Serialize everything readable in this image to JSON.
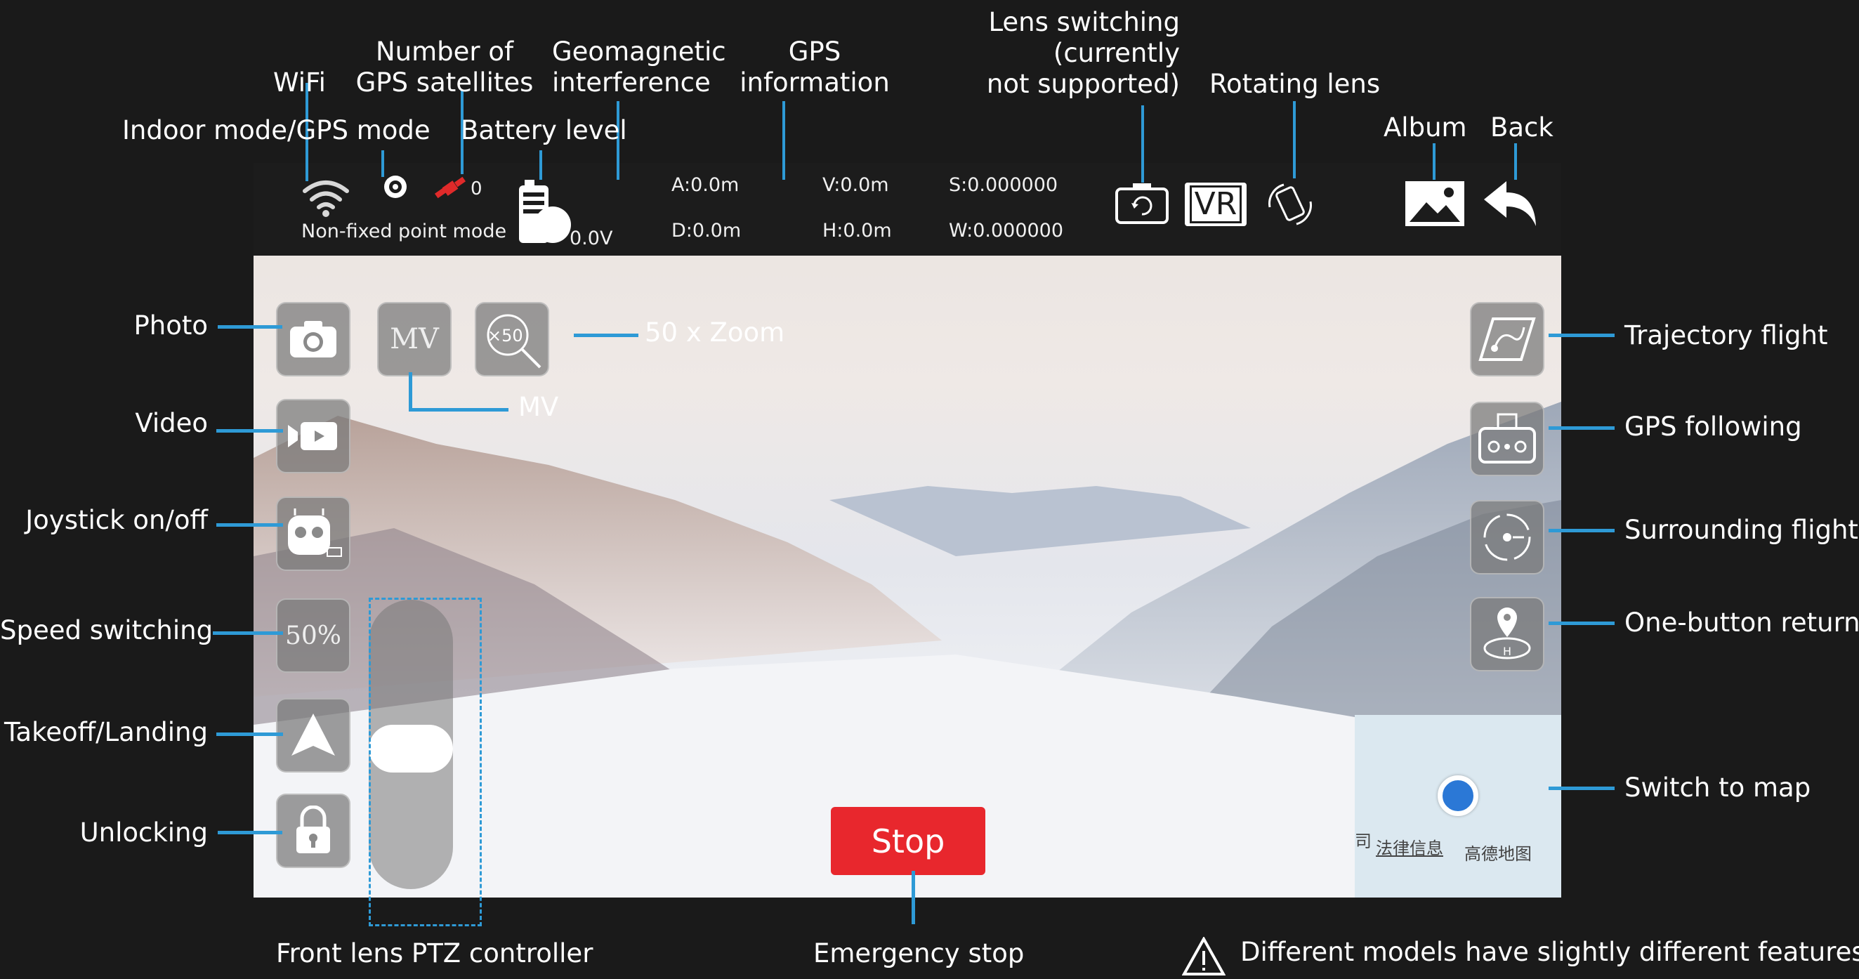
{
  "status_bar": {
    "mode_text": "Non-fixed point mode",
    "satellites": "0",
    "voltage": "0.0V",
    "gps": {
      "a": "A:0.0m",
      "d": "D:0.0m",
      "v": "V:0.0m",
      "h": "H:0.0m",
      "s": "S:0.000000",
      "w": "W:0.000000"
    },
    "vr_label": "VR"
  },
  "left_buttons": {
    "speed": "50%",
    "mv": "MV",
    "zoom": "×50"
  },
  "stop_label": "Stop",
  "map": {
    "legal": "法律信息",
    "brand": "高德地图",
    "prefix": "司"
  },
  "annotations": {
    "wifi": "WiFi",
    "satellites": "Number of\nGPS satellites",
    "indoor_mode": "Indoor mode/GPS mode",
    "battery": "Battery level",
    "geomagnetic": "Geomagnetic\ninterference",
    "gps_info": "GPS\ninformation",
    "lens_switch": "Lens switching\n(currently\nnot supported)",
    "rotating_lens": "Rotating lens",
    "album": "Album",
    "back": "Back",
    "photo": "Photo",
    "video": "Video",
    "joystick": "Joystick on/off",
    "speed": "Speed switching",
    "takeoff": "Takeoff/Landing",
    "unlocking": "Unlocking",
    "zoom": "50 x Zoom",
    "mv": "MV",
    "trajectory": "Trajectory flight",
    "gps_following": "GPS following",
    "surrounding": "Surrounding flight",
    "return": "One-button return",
    "switch_map": "Switch to map",
    "ptz": "Front lens PTZ controller",
    "emergency": "Emergency stop",
    "note": "Different models have slightly different features. I"
  },
  "colors": {
    "accent": "#2e9ad6",
    "stop": "#e8272d",
    "background": "#1a1a1a"
  }
}
